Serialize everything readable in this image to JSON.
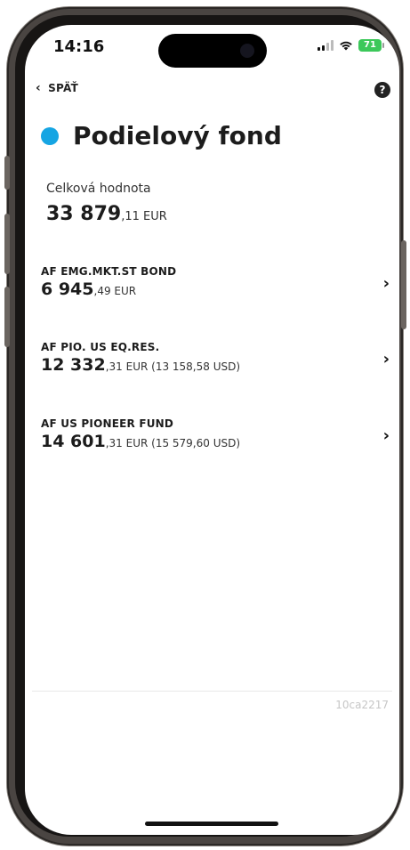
{
  "status_bar": {
    "time": "14:16",
    "battery": "71"
  },
  "nav": {
    "back_label": "SPÄŤ",
    "help_label": "?"
  },
  "page": {
    "title": "Podielový fond",
    "accent_color": "#16a5e3"
  },
  "total": {
    "label": "Celková hodnota",
    "value_main": "33 879",
    "value_decimals": ",11 EUR"
  },
  "funds": [
    {
      "name": "AF EMG.MKT.ST BOND",
      "value_main": "6 945",
      "value_rest": ",49 EUR"
    },
    {
      "name": "AF PIO. US EQ.RES.",
      "value_main": "12 332",
      "value_rest": ",31 EUR (13 158,58 USD)"
    },
    {
      "name": "AF US PIONEER FUND",
      "value_main": "14 601",
      "value_rest": ",31 EUR (15 579,60 USD)"
    }
  ],
  "footer": {
    "build_id": "10ca2217"
  },
  "icons": {
    "back": "chevron-left-icon",
    "help": "question-icon",
    "row": "chevron-right-icon"
  }
}
